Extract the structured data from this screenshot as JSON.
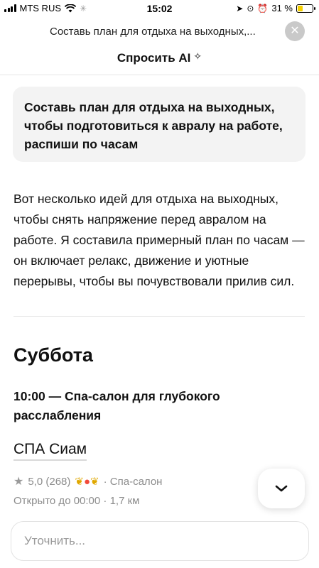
{
  "status_bar": {
    "carrier": "MTS RUS",
    "time": "15:02",
    "battery": "31 %"
  },
  "header": {
    "query_title": "Составь план для отдыха на выходных,...",
    "close_icon": "close-icon",
    "ai_label": "Спросить AI",
    "ai_icon": "sparkle-icon"
  },
  "chat": {
    "user_message": "Составь план для отдыха на выходных, чтобы подготовиться к авралу на работе, распиши по часам",
    "answer_intro": "Вот несколько идей для отдыха на выходных, чтобы снять напряжение перед авралом на работе. Я составила примерный план по часам — он включает релакс, движение и уютные перерывы, чтобы вы почувствовали прилив сил.",
    "day_heading": "Суббота",
    "plan_item": "10:00 — Спа-салон для глубокого расслабления",
    "place": {
      "name": "СПА Сиам",
      "rating": "5,0 (268)",
      "category": "· Спа-салон",
      "hours": "Открыто до 00:00",
      "distance": "· 1,7 км"
    }
  },
  "input": {
    "placeholder": "Уточнить..."
  },
  "colors": {
    "bubble_bg": "#f3f3f3",
    "muted_text": "#8c8c8c",
    "award_gold": "#e0a800",
    "award_pin": "#f24a3a",
    "battery_fill": "#f5d000"
  }
}
